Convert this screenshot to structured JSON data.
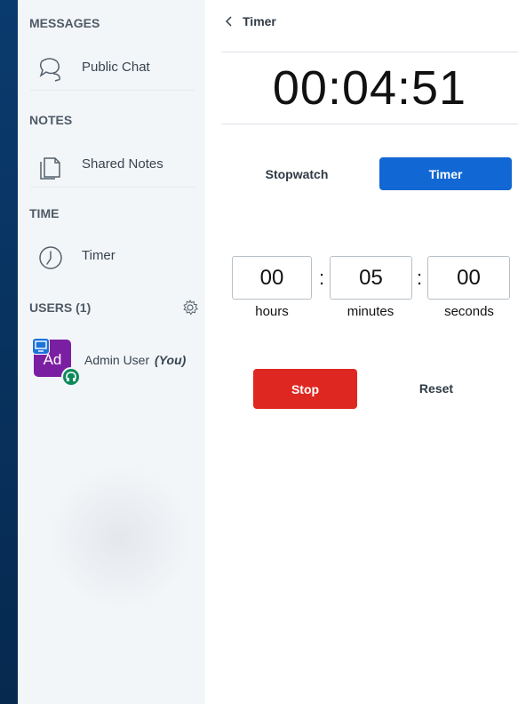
{
  "sidebar": {
    "sections": {
      "messages": "MESSAGES",
      "notes": "NOTES",
      "time": "TIME",
      "users": "USERS (1)"
    },
    "items": {
      "public_chat": "Public Chat",
      "shared_notes": "Shared Notes",
      "timer": "Timer"
    },
    "user": {
      "avatar_initials": "Ad",
      "name": "Admin User",
      "you_label": "(You)"
    }
  },
  "panel": {
    "back_label": "Timer",
    "time_display": "00:04:51",
    "tabs": {
      "stopwatch": "Stopwatch",
      "timer": "Timer"
    },
    "inputs": {
      "hours": "00",
      "minutes": "05",
      "seconds": "00",
      "separator": ":"
    },
    "unit_labels": {
      "hours": "hours",
      "minutes": "minutes",
      "seconds": "seconds"
    },
    "buttons": {
      "stop": "Stop",
      "reset": "Reset"
    }
  },
  "colors": {
    "accent": "#1167d4",
    "danger": "#df2721",
    "avatar": "#7b1fa2",
    "audio_badge": "#0c8a5a"
  },
  "icons": {
    "chat": "chat-bubbles-icon",
    "notes": "notes-document-icon",
    "timer": "clock-icon",
    "settings": "gear-icon",
    "back": "chevron-left-icon",
    "presenter": "presenter-icon",
    "audio": "headset-icon"
  }
}
